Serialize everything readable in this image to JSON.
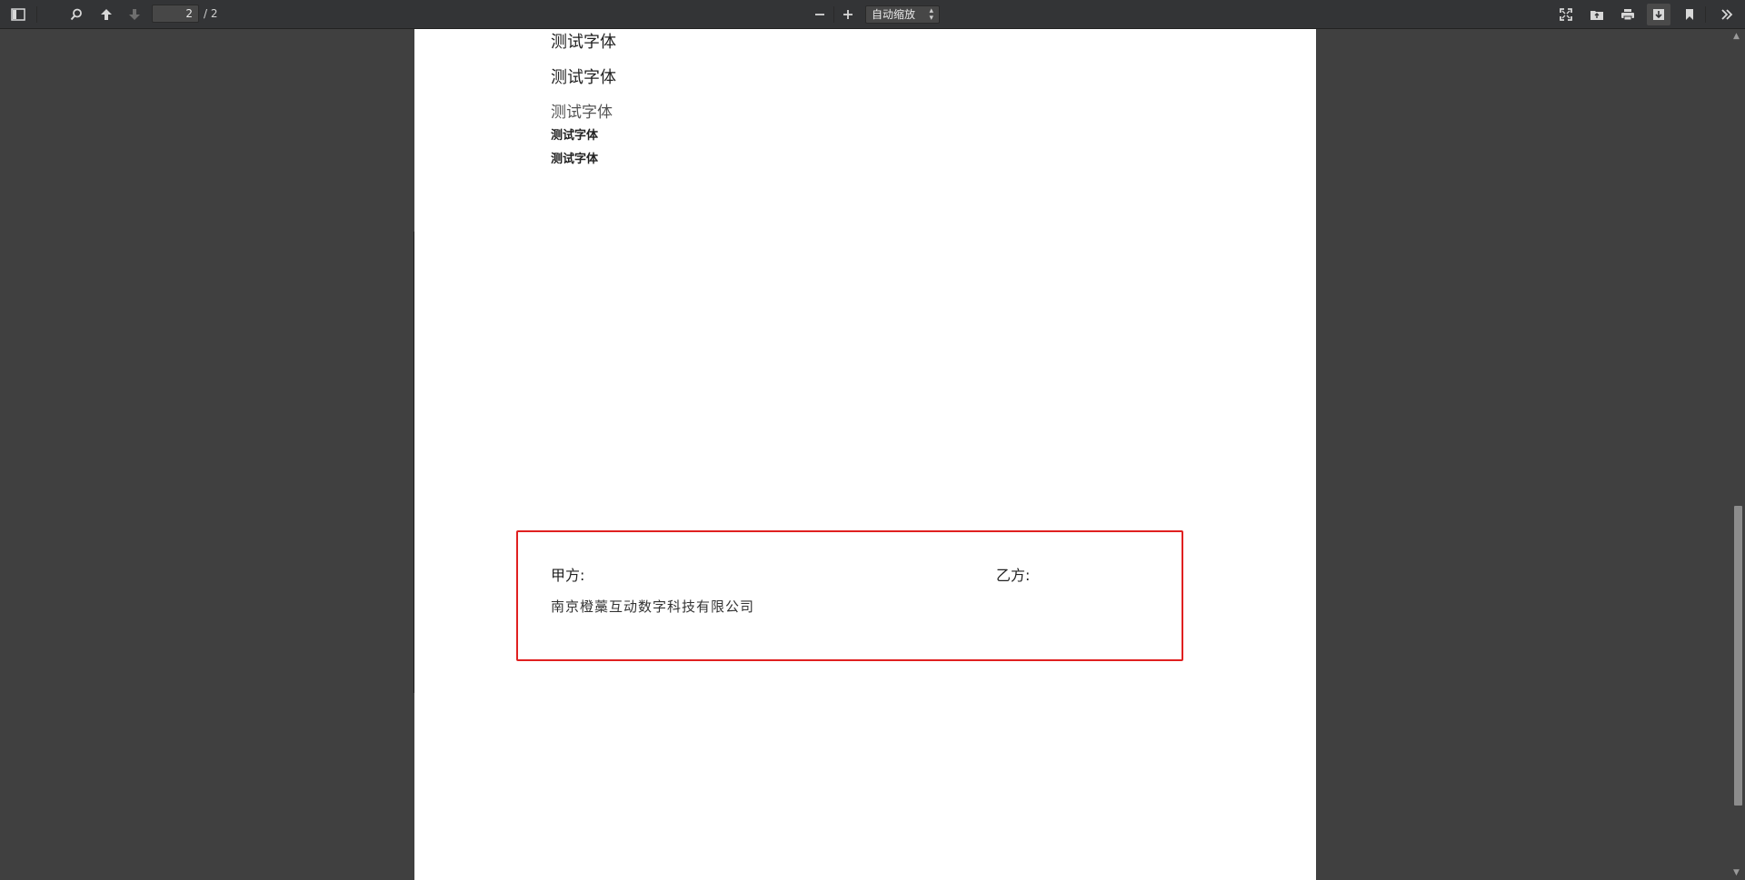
{
  "toolbar": {
    "page_number": "2",
    "page_total": "/ 2",
    "zoom_label": "自动缩放",
    "icons": {
      "sidebar": "sidebar-toggle-icon",
      "search": "search-icon",
      "prev": "arrow-up-icon",
      "next": "arrow-down-icon",
      "zoom_out": "minus-icon",
      "zoom_in": "plus-icon",
      "presentation": "fullscreen-icon",
      "open": "folder-open-icon",
      "print": "print-icon",
      "download": "download-icon",
      "bookmark": "bookmark-icon",
      "tools": "double-chevron-right-icon"
    }
  },
  "document": {
    "font_samples": [
      "测试字体",
      "测试字体",
      "测试字体",
      "测试字体",
      "测试字体"
    ],
    "signature": {
      "party_a_label": "甲方:",
      "party_b_label": "乙方:",
      "party_a_company": "南京橙藁互动数字科技有限公司"
    }
  },
  "colors": {
    "toolbar_bg": "#333436",
    "viewer_bg": "#404040",
    "page_bg": "#ffffff",
    "signature_border": "#e02020"
  }
}
